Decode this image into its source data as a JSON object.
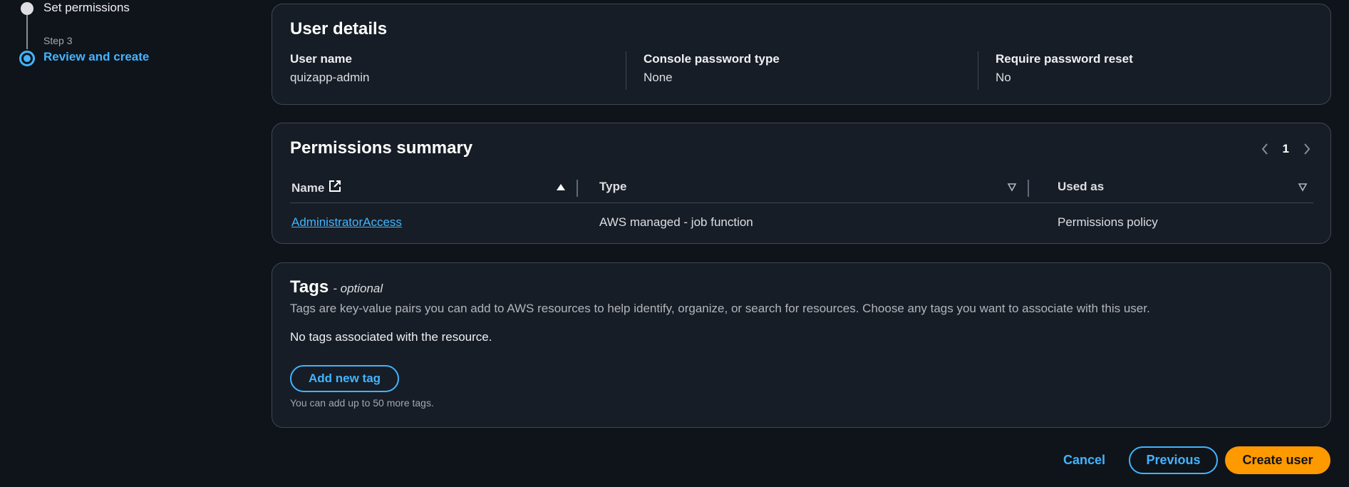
{
  "stepper": {
    "step2_label": "Set permissions",
    "step3_number": "Step 3",
    "step3_label": "Review and create"
  },
  "user_details": {
    "title": "User details",
    "fields": [
      {
        "key": "User name",
        "value": "quizapp-admin"
      },
      {
        "key": "Console password type",
        "value": "None"
      },
      {
        "key": "Require password reset",
        "value": "No"
      }
    ]
  },
  "permissions": {
    "title": "Permissions summary",
    "page": "1",
    "columns": [
      "Name",
      "Type",
      "Used as"
    ],
    "rows": [
      {
        "name": "AdministratorAccess",
        "type": "AWS managed - job function",
        "used_as": "Permissions policy"
      }
    ]
  },
  "tags": {
    "title": "Tags",
    "optional": "- optional",
    "description": "Tags are key-value pairs you can add to AWS resources to help identify, organize, or search for resources. Choose any tags you want to associate with this user.",
    "empty": "No tags associated with the resource.",
    "add_button": "Add new tag",
    "hint": "You can add up to 50 more tags."
  },
  "footer": {
    "cancel": "Cancel",
    "previous": "Previous",
    "create": "Create user"
  },
  "colors": {
    "accent": "#42b4ff",
    "primary_button": "#ff9900",
    "background": "#0f141a",
    "panel": "#161d26"
  }
}
